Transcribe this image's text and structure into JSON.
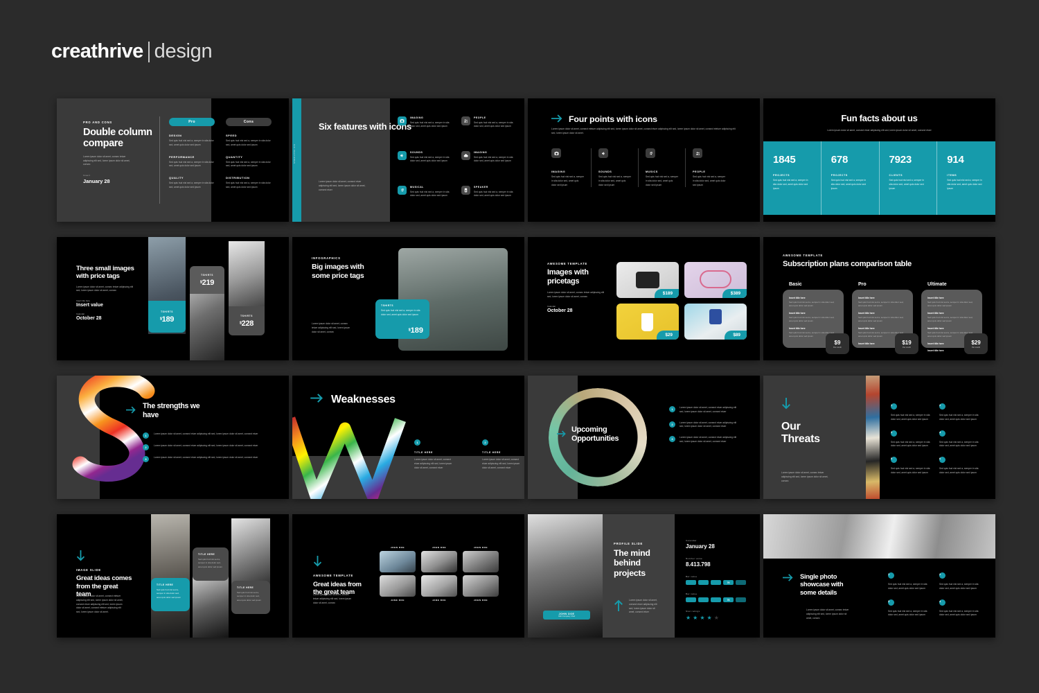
{
  "brand": {
    "bold": "creathrive",
    "light": "design"
  },
  "colors": {
    "accent": "#169bab",
    "background": "#2b2b2b",
    "slide_dark": "#000000",
    "slide_gray": "#3a3a3a"
  },
  "lorem": {
    "short": "Lorem ipsum dolor sit amet, consec tetuer adipiscing elit sed, lorem ipsum dolor sit amet, consec",
    "tiny": "Sed quis hud nisi sed a, semper in sita dolor sed, amet quis dolor sed ipsum",
    "mid": "Lorem ipsum dolor sit amet, consect etuer adipiscing elit sed, lorem ipsum dolor sit amet, consect etuer",
    "long": "Lorem ipsum dolor sit amet, consect etetuer adipiscing elit sed, lorem ipsum dolor sit amet, consect etuer adipiscing elit sed, lorem ipsum dolor sit amet, consect etetuer adipiscing elit sed, lorem ipsum dolor sit amet."
  },
  "slides": [
    {
      "id": "double-column-compare",
      "kicker": "PRO AND CONS",
      "title": "Double column compare",
      "date_label": "Insert",
      "date": "January 28",
      "pill_pro": "Pro",
      "pill_cons": "Cons",
      "pro_items": [
        "DESIGN",
        "PERFORMANCE",
        "QUALITY"
      ],
      "cons_items": [
        "SPEED",
        "QUANTITY",
        "DISTRIBUTION"
      ]
    },
    {
      "id": "six-features-with-icons",
      "vertical_label": "SIX FEATURES",
      "title": "Six features with icons",
      "features": [
        {
          "label": "IMAGING",
          "icon": "camera-icon",
          "accent": true
        },
        {
          "label": "PEOPLE",
          "icon": "people-icon",
          "accent": false
        },
        {
          "label": "SOUNDS",
          "icon": "volume-icon",
          "accent": true
        },
        {
          "label": "IMAGING",
          "icon": "cloud-icon",
          "accent": false
        },
        {
          "label": "MUSICAL",
          "icon": "music-icon",
          "accent": true
        },
        {
          "label": "SPEAKER",
          "icon": "speaker-icon",
          "accent": false
        }
      ]
    },
    {
      "id": "four-points-with-icons",
      "title": "Four points with icons",
      "points": [
        {
          "label": "IMAGING",
          "icon": "camera-icon",
          "accent": false
        },
        {
          "label": "SOUNDS",
          "icon": "volume-icon",
          "accent": false
        },
        {
          "label": "MUSICS",
          "icon": "music-icon",
          "accent": false
        },
        {
          "label": "PEOPLE",
          "icon": "people-icon",
          "accent": true
        }
      ]
    },
    {
      "id": "fun-facts-about-us",
      "title": "Fun facts about us",
      "stats": [
        {
          "number": "1845",
          "label": "PROJECTS"
        },
        {
          "number": "678",
          "label": "PROJECTS"
        },
        {
          "number": "7923",
          "label": "CLIENTS"
        },
        {
          "number": "914",
          "label": "ITEMS"
        }
      ]
    },
    {
      "id": "three-small-images-with-price-tags",
      "title": "Three small images with price tags",
      "value_label": "Insert title here",
      "value": "Insert value",
      "date_label": "Calendar",
      "date": "October 28",
      "tags": [
        {
          "label": "TSHIRTS",
          "price": "189",
          "accent": true
        },
        {
          "label": "TSHIRTS",
          "price": "219",
          "accent": false
        },
        {
          "label": "TSHIRTS",
          "price": "228",
          "accent": false
        }
      ]
    },
    {
      "id": "big-images-with-price-tags",
      "kicker": "INFOGRAPHICS",
      "title": "Big images with some price tags",
      "card_label": "TSHIRTS",
      "card_price": "189"
    },
    {
      "id": "images-with-pricetags",
      "kicker": "AWESOME TEMPLATE",
      "title": "Images with pricetags",
      "date_label": "Calendar",
      "date": "October 28",
      "products": [
        {
          "name": "camera-lens",
          "price": "$189"
        },
        {
          "name": "bicycle",
          "price": "$389"
        },
        {
          "name": "coffee-cup",
          "price": "$29"
        },
        {
          "name": "high-heel-shoe",
          "price": "$89"
        }
      ]
    },
    {
      "id": "subscription-plans-comparison-table",
      "kicker": "AWESOME TEMPLATE",
      "title": "Subscription plans comparison table",
      "per_month": "Per month",
      "row_title": "Insert title here",
      "plans": [
        {
          "name": "Basic",
          "price": "$9",
          "rows": 3,
          "accent": false
        },
        {
          "name": "Pro",
          "price": "$19",
          "rows": 4,
          "accent": false
        },
        {
          "name": "Ultimate",
          "price": "$29",
          "rows": 5,
          "accent": true
        }
      ]
    },
    {
      "id": "the-strengths-we-have",
      "letter": "S",
      "title": "The strengths we have",
      "bullets": [
        "1",
        "2",
        "3"
      ]
    },
    {
      "id": "weaknesses",
      "letter": "W",
      "title": "Weaknesses",
      "items": [
        {
          "num": "1",
          "title": "TITLE HERE"
        },
        {
          "num": "2",
          "title": "TITLE HERE"
        }
      ]
    },
    {
      "id": "upcoming-opportunities",
      "letter": "O",
      "title_line1": "Upcoming",
      "title_line2": "Opportunities",
      "bullets": [
        "1",
        "2",
        "3"
      ]
    },
    {
      "id": "our-threats",
      "letter": "T",
      "title_line1": "Our",
      "title_line2": "Threats",
      "bullets": [
        "1",
        "2",
        "3",
        "4",
        "5",
        "6"
      ]
    },
    {
      "id": "great-ideas-comes-from-the-great-team",
      "kicker": "IMAGE SLIDE",
      "title": "Great ideas comes from the great team",
      "cards": [
        {
          "title": "TITLE HERE",
          "accent": true
        },
        {
          "title": "TITLE HERE",
          "accent": false
        },
        {
          "title": "TITLE HERE",
          "accent": false
        }
      ]
    },
    {
      "id": "great-ideas-from-the-great-team",
      "kicker": "AWESOME TEMPLATE",
      "title": "Great ideas from the great team",
      "people_top": [
        "JOHN DOE",
        "JOHN DOE",
        "JOHN DOE"
      ],
      "people_bottom": [
        "JANE DOE",
        "JANE DOE",
        "JOHN DOE"
      ]
    },
    {
      "id": "the-mind-behind-projects",
      "kicker": "PROFILE SLIDE",
      "title": "The mind behind projects",
      "name_badge": "JOHN DOE",
      "name_role": "CEO Company Chief",
      "date_label": "Calendar",
      "date": "January 28",
      "number_label": "Number value",
      "number": "8.413.798",
      "bar_label_1": "Bar value",
      "bar_label_2": "Bar value",
      "bar_value_1": "76",
      "bar_value_2": "76",
      "rating_label": "Star ratings",
      "rating": 4,
      "rating_total": 5
    },
    {
      "id": "single-photo-showcase",
      "title": "Single photo showcase with some details",
      "bullets": [
        "1",
        "2",
        "3",
        "4"
      ]
    }
  ]
}
